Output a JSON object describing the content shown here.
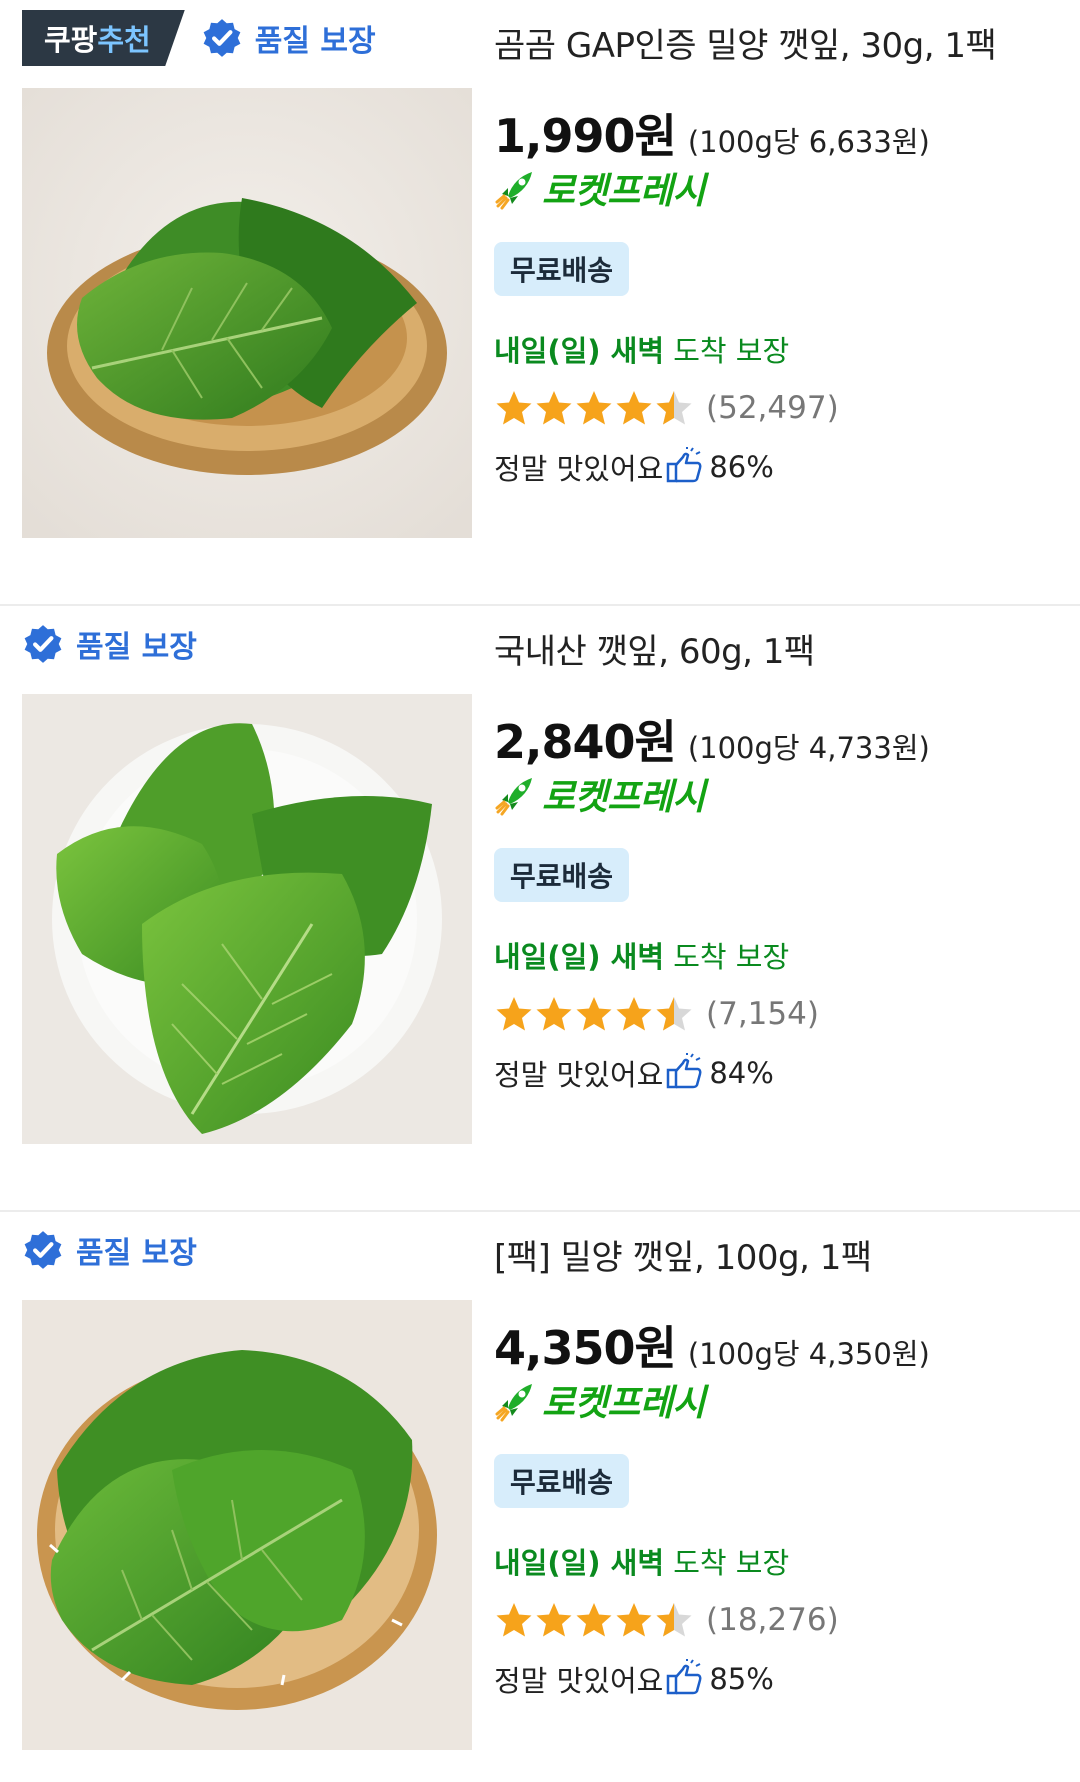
{
  "products": [
    {
      "coupang_pick": {
        "part1": "쿠팡",
        "part2": "추천"
      },
      "quality_badge": "품질 보장",
      "title": "곰곰 GAP인증 밀양 깻잎, 30g, 1팩",
      "price": "1,990원",
      "unit_price": "(100g당 6,633원)",
      "delivery_badge": "로켓프레시",
      "free_shipping": "무료배송",
      "arrival_bold": "내일(일) 새벽",
      "arrival_rest": " 도착 보장",
      "rating": 4.5,
      "review_count": "(52,497)",
      "taste_label": "정말 맛있어요",
      "taste_percent": "86%",
      "image_alt": "perilla leaves on woven basket"
    },
    {
      "quality_badge": "품질 보장",
      "title": "국내산 깻잎, 60g, 1팩",
      "price": "2,840원",
      "unit_price": "(100g당 4,733원)",
      "delivery_badge": "로켓프레시",
      "free_shipping": "무료배송",
      "arrival_bold": "내일(일) 새벽",
      "arrival_rest": " 도착 보장",
      "rating": 4.5,
      "review_count": "(7,154)",
      "taste_label": "정말 맛있어요",
      "taste_percent": "84%",
      "image_alt": "perilla leaves on white plate"
    },
    {
      "quality_badge": "품질 보장",
      "title": "[팩] 밀양 깻잎, 100g, 1팩",
      "price": "4,350원",
      "unit_price": "(100g당 4,350원)",
      "delivery_badge": "로켓프레시",
      "free_shipping": "무료배송",
      "arrival_bold": "내일(일) 새벽",
      "arrival_rest": " 도착 보장",
      "rating": 4.5,
      "review_count": "(18,276)",
      "taste_label": "정말 맛있어요",
      "taste_percent": "85%",
      "image_alt": "perilla leaves on bamboo tray"
    }
  ],
  "colors": {
    "quality_blue": "#2e6fd8",
    "rocket_green": "#13a313",
    "arrival_green": "#0a8a1f",
    "star_orange": "#f6a31b",
    "free_ship_bg": "#d7edfb",
    "pick_bg": "#2c3844"
  },
  "icons": [
    "verified-check-icon",
    "rocket-icon",
    "star-icon",
    "thumbs-up-icon"
  ]
}
